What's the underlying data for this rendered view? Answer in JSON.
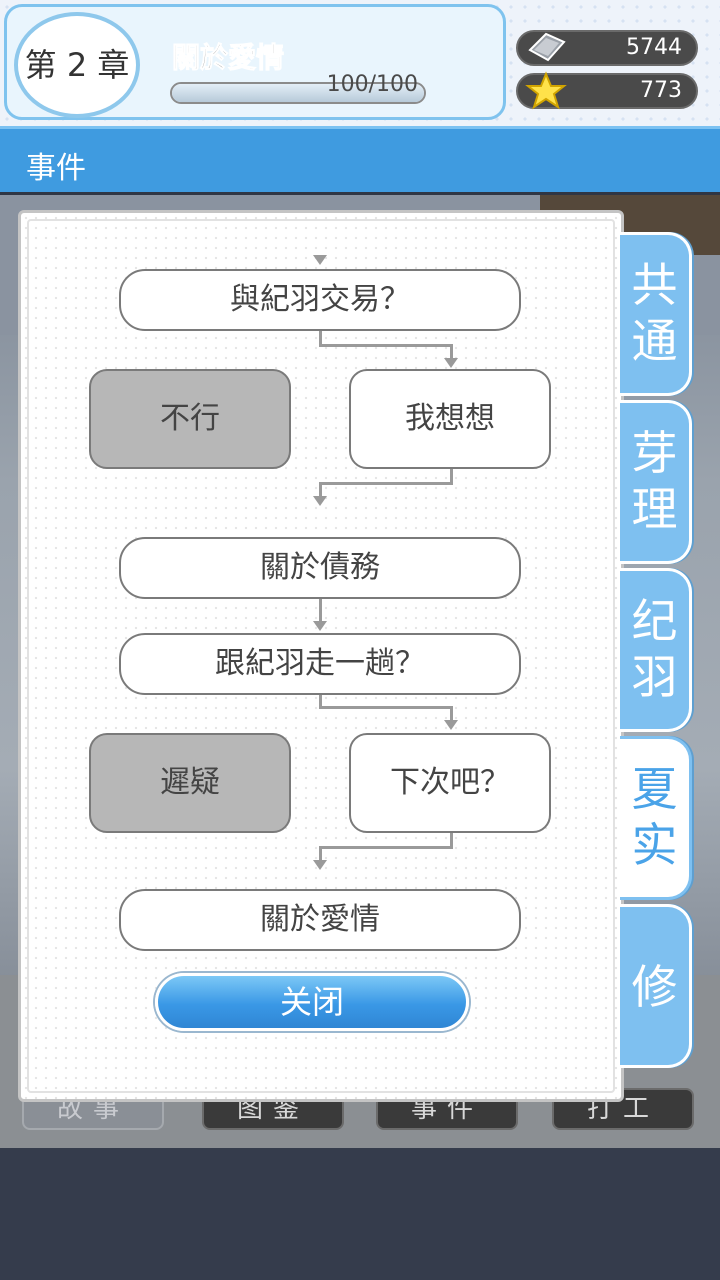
{
  "header": {
    "chapter_label": "第 2 章",
    "chapter_title": "關於愛情",
    "progress_text": "100/100",
    "progress_fraction": 1.0,
    "currency": [
      {
        "icon": "ticket-icon",
        "value": "5744"
      },
      {
        "icon": "star-icon",
        "value": "773"
      }
    ]
  },
  "section": {
    "title": "事件"
  },
  "flow": {
    "nodes": [
      {
        "id": "n1",
        "label": "與紀羽交易？",
        "style": "wide"
      },
      {
        "id": "n2",
        "label": "不行",
        "style": "gray"
      },
      {
        "id": "n3",
        "label": "我想想",
        "style": "box"
      },
      {
        "id": "n4",
        "label": "關於債務",
        "style": "wide"
      },
      {
        "id": "n5",
        "label": "跟紀羽走一趟？",
        "style": "wide"
      },
      {
        "id": "n6",
        "label": "遲疑",
        "style": "gray"
      },
      {
        "id": "n7",
        "label": "下次吧？",
        "style": "box"
      },
      {
        "id": "n8",
        "label": "關於愛情",
        "style": "wide"
      }
    ]
  },
  "modal": {
    "close_label": "关闭"
  },
  "side_tabs": [
    {
      "label": "共通",
      "active": false
    },
    {
      "label": "芽理",
      "active": false
    },
    {
      "label": "纪羽",
      "active": false
    },
    {
      "label": "夏实",
      "active": true
    },
    {
      "label": "修",
      "active": false
    }
  ],
  "bottom_tabs": [
    "故事",
    "图鉴",
    "事件",
    "打工"
  ]
}
